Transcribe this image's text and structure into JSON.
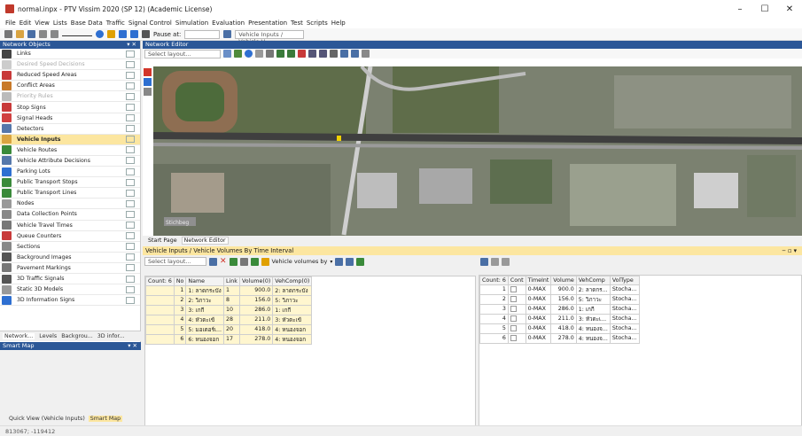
{
  "app": {
    "window_title": "normal.inpx - PTV Vissim 2020 (SP 12) (Academic License)"
  },
  "menu": [
    "File",
    "Edit",
    "View",
    "Lists",
    "Base Data",
    "Traffic",
    "Signal Control",
    "Simulation",
    "Evaluation",
    "Presentation",
    "Test",
    "Scripts",
    "Help"
  ],
  "toolbar": {
    "pause_at_label": "Pause at:",
    "list_selector_value": "Vehicle Inputs / Vehicle V"
  },
  "network_objects": {
    "title": "Network Objects",
    "items": [
      {
        "label": "Links",
        "icon": "links-icon",
        "dim": false,
        "selected": false
      },
      {
        "label": "Desired Speed Decisions",
        "icon": "desired-speed-icon",
        "dim": true,
        "selected": false
      },
      {
        "label": "Reduced Speed Areas",
        "icon": "reduced-speed-icon",
        "dim": false,
        "selected": false
      },
      {
        "label": "Conflict Areas",
        "icon": "conflict-areas-icon",
        "dim": false,
        "selected": false
      },
      {
        "label": "Priority Rules",
        "icon": "priority-rules-icon",
        "dim": true,
        "selected": false
      },
      {
        "label": "Stop Signs",
        "icon": "stop-sign-icon",
        "dim": false,
        "selected": false
      },
      {
        "label": "Signal Heads",
        "icon": "signal-heads-icon",
        "dim": false,
        "selected": false
      },
      {
        "label": "Detectors",
        "icon": "detectors-icon",
        "dim": false,
        "selected": false
      },
      {
        "label": "Vehicle Inputs",
        "icon": "vehicle-inputs-icon",
        "dim": false,
        "selected": true
      },
      {
        "label": "Vehicle Routes",
        "icon": "vehicle-routes-icon",
        "dim": false,
        "selected": false
      },
      {
        "label": "Vehicle Attribute Decisions",
        "icon": "vehicle-attribute-icon",
        "dim": false,
        "selected": false
      },
      {
        "label": "Parking Lots",
        "icon": "parking-icon",
        "dim": false,
        "selected": false
      },
      {
        "label": "Public Transport Stops",
        "icon": "pt-stops-icon",
        "dim": false,
        "selected": false
      },
      {
        "label": "Public Transport Lines",
        "icon": "pt-lines-icon",
        "dim": false,
        "selected": false
      },
      {
        "label": "Nodes",
        "icon": "nodes-icon",
        "dim": false,
        "selected": false
      },
      {
        "label": "Data Collection Points",
        "icon": "data-collection-icon",
        "dim": false,
        "selected": false
      },
      {
        "label": "Vehicle Travel Times",
        "icon": "travel-times-icon",
        "dim": false,
        "selected": false
      },
      {
        "label": "Queue Counters",
        "icon": "queue-counters-icon",
        "dim": false,
        "selected": false
      },
      {
        "label": "Sections",
        "icon": "sections-icon",
        "dim": false,
        "selected": false
      },
      {
        "label": "Background Images",
        "icon": "background-images-icon",
        "dim": false,
        "selected": false
      },
      {
        "label": "Pavement Markings",
        "icon": "pavement-markings-icon",
        "dim": false,
        "selected": false
      },
      {
        "label": "3D Traffic Signals",
        "icon": "3d-signals-icon",
        "dim": false,
        "selected": false
      },
      {
        "label": "Static 3D Models",
        "icon": "static-3d-icon",
        "dim": false,
        "selected": false
      },
      {
        "label": "3D Information Signs",
        "icon": "3d-info-signs-icon",
        "dim": false,
        "selected": false
      }
    ],
    "tabs": [
      "Network...",
      "Levels",
      "Backgrou...",
      "3D infor..."
    ]
  },
  "smart_map": {
    "title": "Smart Map",
    "tabs": [
      "Quick View (Vehicle Inputs)",
      "Smart Map"
    ]
  },
  "network_editor": {
    "title": "Network Editor",
    "layout_select": "Select layout...",
    "tabs": [
      "Start Page",
      "Network Editor"
    ],
    "map_watermark": "Stichbeg"
  },
  "vehicle_inputs_list": {
    "title": "Vehicle Inputs / Vehicle Volumes By Time Interval",
    "layout_select": "Select layout...",
    "volumes_filter": "Vehicle volumes by",
    "left_columns": [
      "Count: 6",
      "No",
      "Name",
      "Link",
      "Volume(0)",
      "VehComp(0)"
    ],
    "left_rows": [
      {
        "no": "1",
        "name": "1: ลาดกระบัง",
        "link": "1",
        "volume": "900.0",
        "vehcomp": "2: ลาดกระบัง"
      },
      {
        "no": "2",
        "name": "2: วิภาวะ",
        "link": "8",
        "volume": "156.0",
        "vehcomp": "5: วิภาวะ"
      },
      {
        "no": "3",
        "name": "3: เกกี",
        "link": "10",
        "volume": "286.0",
        "vehcomp": "1: เกกี"
      },
      {
        "no": "4",
        "name": "4: หัวตะเข้",
        "link": "28",
        "volume": "211.0",
        "vehcomp": "3: หัวตะเข้"
      },
      {
        "no": "5",
        "name": "5: มอเตอร์เ...",
        "link": "20",
        "volume": "418.0",
        "vehcomp": "4: หนองจอก"
      },
      {
        "no": "6",
        "name": "6: หนองจอก",
        "link": "17",
        "volume": "278.0",
        "vehcomp": "4: หนองจอก"
      }
    ],
    "right_columns": [
      "Count: 6",
      "Cont",
      "TimeInt",
      "Volume",
      "VehComp",
      "VolType"
    ],
    "right_rows": [
      {
        "idx": "1",
        "timeint": "0-MAX",
        "volume": "900.0",
        "vehcomp": "2: ลาดกร...",
        "voltype": "Stocha..."
      },
      {
        "idx": "2",
        "timeint": "0-MAX",
        "volume": "156.0",
        "vehcomp": "5: วิภาวะ",
        "voltype": "Stocha..."
      },
      {
        "idx": "3",
        "timeint": "0-MAX",
        "volume": "286.0",
        "vehcomp": "1: เกกี",
        "voltype": "Stocha..."
      },
      {
        "idx": "4",
        "timeint": "0-MAX",
        "volume": "211.0",
        "vehcomp": "3: หัวตะเ...",
        "voltype": "Stocha..."
      },
      {
        "idx": "5",
        "timeint": "0-MAX",
        "volume": "418.0",
        "vehcomp": "4: หนองจ...",
        "voltype": "Stocha..."
      },
      {
        "idx": "6",
        "timeint": "0-MAX",
        "volume": "278.0",
        "vehcomp": "4: หนองจ...",
        "voltype": "Stocha..."
      }
    ]
  },
  "status_bar": {
    "coords": "813067; -119412"
  },
  "colors": {
    "panel_header": "#2b5797",
    "selection": "#fce6a0",
    "list_row": "#fff6cf"
  }
}
